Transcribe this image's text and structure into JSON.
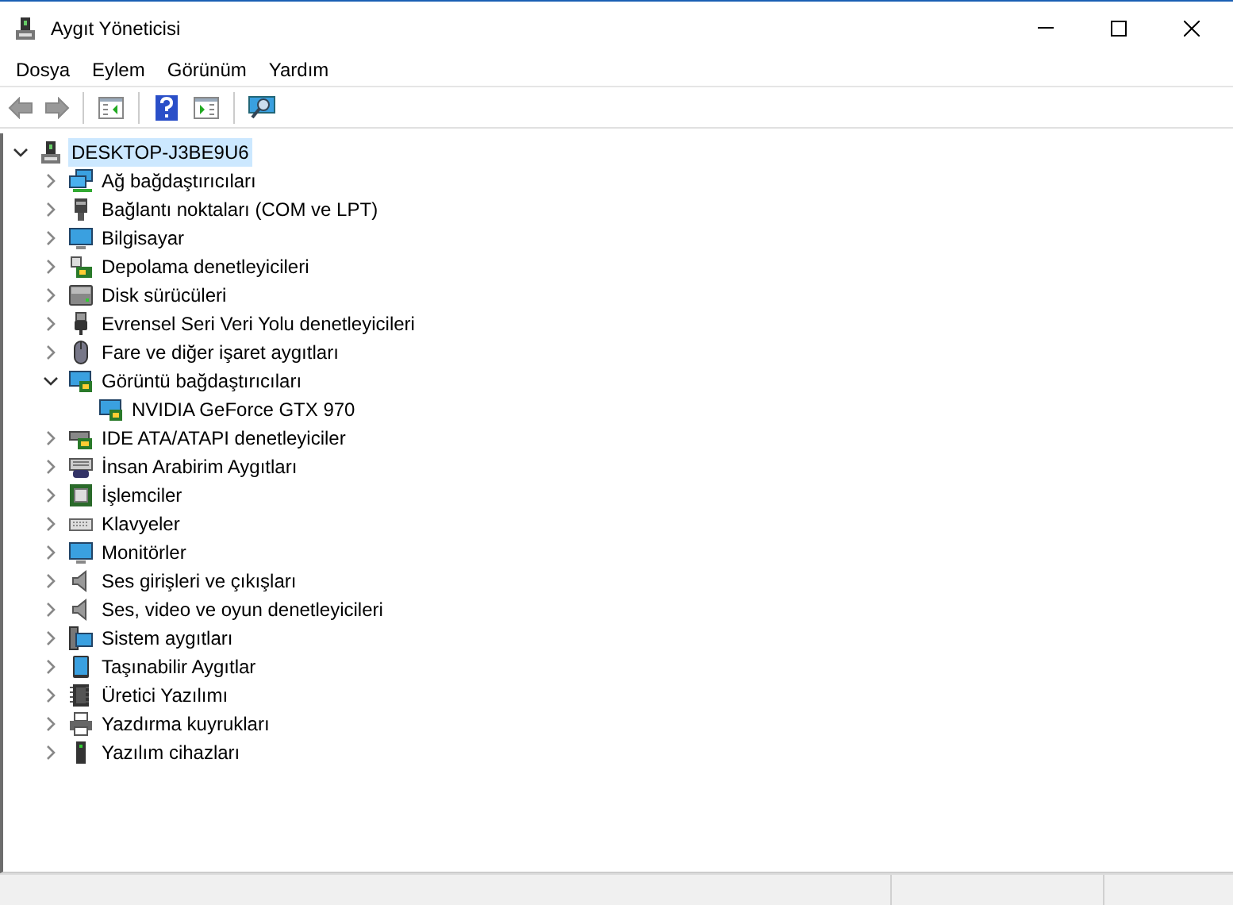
{
  "window": {
    "title": "Aygıt Yöneticisi"
  },
  "menu": [
    "Dosya",
    "Eylem",
    "Görünüm",
    "Yardım"
  ],
  "tree": {
    "label": "DESKTOP-J3BE9U6",
    "kind": "computer-root",
    "expanded": true,
    "selected": true,
    "children": [
      {
        "label": "Ağ bağdaştırıcıları",
        "kind": "network",
        "expanded": false
      },
      {
        "label": "Bağlantı noktaları (COM ve LPT)",
        "kind": "port",
        "expanded": false
      },
      {
        "label": "Bilgisayar",
        "kind": "monitor",
        "expanded": false
      },
      {
        "label": "Depolama denetleyicileri",
        "kind": "storage",
        "expanded": false
      },
      {
        "label": "Disk sürücüleri",
        "kind": "disk",
        "expanded": false
      },
      {
        "label": "Evrensel Seri Veri Yolu denetleyicileri",
        "kind": "usb",
        "expanded": false
      },
      {
        "label": "Fare ve diğer işaret aygıtları",
        "kind": "mouse",
        "expanded": false
      },
      {
        "label": "Görüntü bağdaştırıcıları",
        "kind": "display",
        "expanded": true,
        "children": [
          {
            "label": "NVIDIA GeForce GTX 970",
            "kind": "display"
          }
        ]
      },
      {
        "label": "IDE ATA/ATAPI denetleyiciler",
        "kind": "ide",
        "expanded": false
      },
      {
        "label": "İnsan Arabirim Aygıtları",
        "kind": "hid",
        "expanded": false
      },
      {
        "label": "İşlemciler",
        "kind": "cpu",
        "expanded": false
      },
      {
        "label": "Klavyeler",
        "kind": "keyboard",
        "expanded": false
      },
      {
        "label": "Monitörler",
        "kind": "monitor",
        "expanded": false
      },
      {
        "label": "Ses girişleri ve çıkışları",
        "kind": "speaker",
        "expanded": false
      },
      {
        "label": "Ses, video ve oyun denetleyicileri",
        "kind": "speaker",
        "expanded": false
      },
      {
        "label": "Sistem aygıtları",
        "kind": "system",
        "expanded": false
      },
      {
        "label": "Taşınabilir Aygıtlar",
        "kind": "portable",
        "expanded": false
      },
      {
        "label": "Üretici Yazılımı",
        "kind": "firmware",
        "expanded": false
      },
      {
        "label": "Yazdırma kuyrukları",
        "kind": "printer",
        "expanded": false
      },
      {
        "label": "Yazılım cihazları",
        "kind": "software",
        "expanded": false
      }
    ]
  }
}
